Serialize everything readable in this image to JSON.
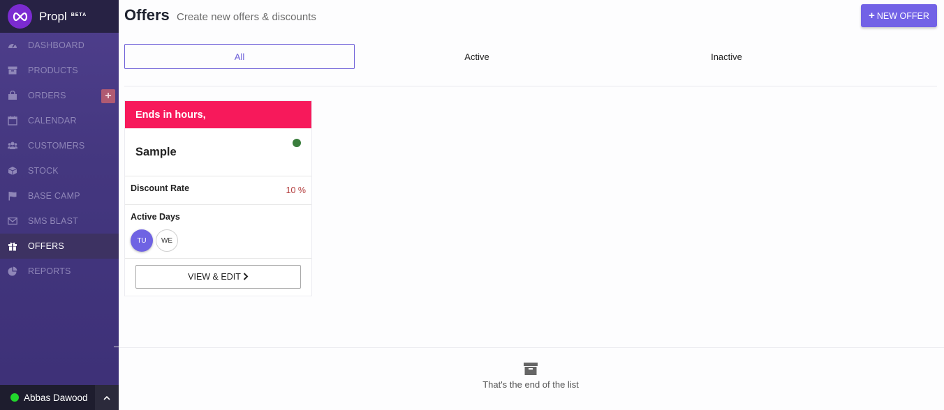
{
  "brand": {
    "name": "Propl",
    "badge": "BETA"
  },
  "sidebar": {
    "items": [
      {
        "label": "DASHBOARD",
        "icon": "dashboard-icon"
      },
      {
        "label": "PRODUCTS",
        "icon": "archive-icon"
      },
      {
        "label": "ORDERS",
        "icon": "shopping-bag-icon"
      },
      {
        "label": "CALENDAR",
        "icon": "calendar-icon"
      },
      {
        "label": "CUSTOMERS",
        "icon": "users-icon"
      },
      {
        "label": "STOCK",
        "icon": "cube-icon"
      },
      {
        "label": "BASE CAMP",
        "icon": "flag-icon"
      },
      {
        "label": "SMS BLAST",
        "icon": "envelope-icon"
      },
      {
        "label": "OFFERS",
        "icon": "gift-icon",
        "active": true
      },
      {
        "label": "REPORTS",
        "icon": "pie-chart-icon"
      }
    ],
    "orders_add_badge": "+"
  },
  "user": {
    "name": "Abbas Dawood",
    "status_color": "#22d72c"
  },
  "header": {
    "title": "Offers",
    "subtitle": "Create new offers & discounts",
    "new_offer_label": "NEW OFFER",
    "new_offer_icon": "+"
  },
  "tabs": [
    {
      "label": "All",
      "selected": true
    },
    {
      "label": "Active"
    },
    {
      "label": "Inactive"
    }
  ],
  "offer_card": {
    "banner": "Ends in hours,",
    "banner_color": "#f7195b",
    "title": "Sample",
    "status_color": "#3a7d3c",
    "discount_label": "Discount Rate",
    "discount_value": "10 %",
    "active_days_label": "Active Days",
    "days": [
      {
        "label": "TU",
        "selected": true
      },
      {
        "label": "WE",
        "selected": false
      }
    ],
    "view_edit_label": "VIEW & EDIT",
    "view_edit_icon": "chevron-right-icon"
  },
  "footer": {
    "end_text": "That's the end of the list"
  },
  "colors": {
    "accent": "#7262e6",
    "sidebar": "#44377f"
  }
}
